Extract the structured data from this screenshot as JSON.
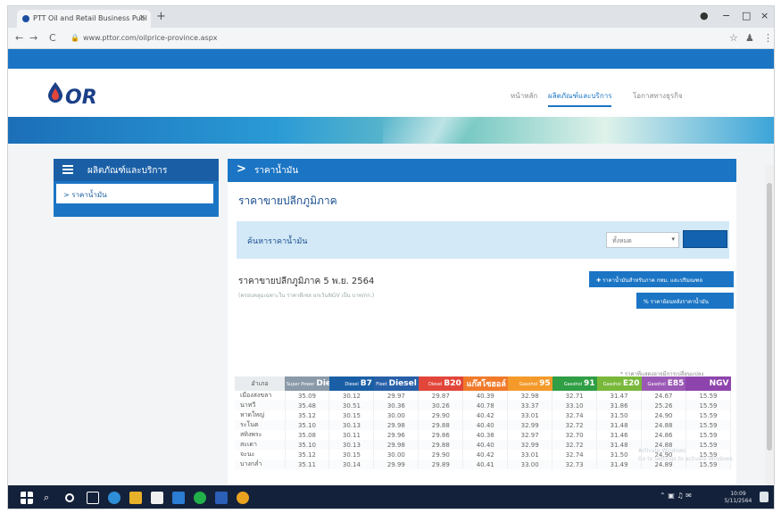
{
  "browser": {
    "tab_title": "PTT Oil and Retail Business Publ",
    "tab_close": "×",
    "new_tab": "+",
    "url": "www.pttor.com/oilprice-province.aspx",
    "back": "←",
    "forward": "→",
    "reload": "C",
    "star": "☆",
    "window_minimize": "−",
    "window_maximize": "□",
    "window_close": "×"
  },
  "site": {
    "logo_text": "OR",
    "nav": [
      "หน้าหลัก",
      "ผลิตภัณฑ์และบริการ",
      "โอกาสทางธุรกิจ"
    ],
    "colors": {
      "brand_blue": "#1b75c4",
      "dark_blue": "#1b3f87"
    }
  },
  "sidebar": {
    "heading": "ผลิตภัณฑ์และบริการ",
    "items": [
      {
        "label": "ราคาน้ำมัน"
      }
    ]
  },
  "content": {
    "header": "ราคาน้ำมัน",
    "title": "ราคาขายปลีกภูมิภาค",
    "search_label": "ค้นหาราคาน้ำมัน",
    "province_select": "ทั้งหมด",
    "price_title": "ราคาขายปลีกภูมิภาค 5 พ.ย. 2564",
    "price_subtitle": "(ครอบคลุมเฉพาะใน ราคาดีเซล ยกเว้นNGV เป็น บาท/กก.)",
    "btn_fuel_tax": "ราคาน้ำมันสำหรับภาค กทม. และปริมณฑล",
    "btn_history": "ราคาย้อนหลังราคาน้ำมัน",
    "note": "* ราคาที่แสดงอาจมีการเปลี่ยนแปลง"
  },
  "table": {
    "area_header": "อำเภอ",
    "columns": [
      {
        "small": "Super Power",
        "name": "Diesel",
        "color": "#8a9aa8"
      },
      {
        "small": "Diesel",
        "name": "B7",
        "color": "#1a5fa6"
      },
      {
        "small": "Fleet",
        "name": "Diesel",
        "color": "#2860a8"
      },
      {
        "small": "Diesel",
        "name": "B20",
        "color": "#e2463a"
      },
      {
        "small": "",
        "name": "แก๊สโซฮอล์",
        "color": "#f07a2a"
      },
      {
        "small": "Gasohol",
        "name": "95",
        "color": "#f39a2a"
      },
      {
        "small": "Gasohol",
        "name": "91",
        "color": "#2f9e44"
      },
      {
        "small": "Gasohol",
        "name": "E20",
        "color": "#79b83a"
      },
      {
        "small": "Gasohol",
        "name": "E85",
        "color": "#9b59b6"
      },
      {
        "small": "",
        "name": "NGV",
        "color": "#8e44ad"
      }
    ],
    "rows": [
      [
        "เมืองสงขลา",
        "35.09",
        "30.12",
        "29.97",
        "29.87",
        "40.39",
        "32.98",
        "32.71",
        "31.47",
        "24.67",
        "15.59"
      ],
      [
        "นาทวี",
        "35.48",
        "30.51",
        "30.36",
        "30.26",
        "40.78",
        "33.37",
        "33.10",
        "31.86",
        "25.26",
        "15.59"
      ],
      [
        "หาดใหญ่",
        "35.12",
        "30.15",
        "30.00",
        "29.90",
        "40.42",
        "33.01",
        "32.74",
        "31.50",
        "24.90",
        "15.59"
      ],
      [
        "ระโนด",
        "35.10",
        "30.13",
        "29.98",
        "29.88",
        "40.40",
        "32.99",
        "32.72",
        "31.48",
        "24.88",
        "15.59"
      ],
      [
        "สทิงพระ",
        "35.08",
        "30.11",
        "29.96",
        "29.86",
        "40.38",
        "32.97",
        "32.70",
        "31.46",
        "24.86",
        "15.59"
      ],
      [
        "สะเดา",
        "35.10",
        "30.13",
        "29.98",
        "29.88",
        "40.40",
        "32.99",
        "32.72",
        "31.48",
        "24.88",
        "15.59"
      ],
      [
        "จะนะ",
        "35.12",
        "30.15",
        "30.00",
        "29.90",
        "40.42",
        "33.01",
        "32.74",
        "31.50",
        "24.90",
        "15.59"
      ],
      [
        "บางกล่ำ",
        "35.11",
        "30.14",
        "29.99",
        "29.89",
        "40.41",
        "33.00",
        "32.73",
        "31.49",
        "24.89",
        "15.59"
      ]
    ]
  },
  "watermark": [
    "Activate Windows",
    "Go to Settings to activate Windows."
  ],
  "taskbar": {
    "time": "10:09",
    "date": "5/11/2564"
  }
}
